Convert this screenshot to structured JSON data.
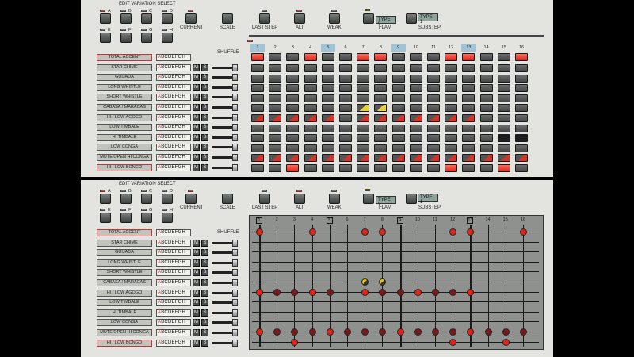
{
  "colors": {
    "panel": "#e3e3df",
    "accent_red": "#e2231a",
    "flam_yellow": "#f0d838",
    "lcd": "#8ea39a",
    "step_highlight": "#9fc4d8"
  },
  "top": {
    "edit_variation_select": "EDIT VARIATION SELECT",
    "variation_buttons": [
      "A",
      "B",
      "C",
      "D",
      "E",
      "F",
      "G",
      "H"
    ],
    "current": "CURRENT",
    "scale": "SCALE",
    "last_step": "LAST STEP",
    "alt": "ALT",
    "weak": "WEAK",
    "flam": "FLAM",
    "flam_type": "TYPE 2",
    "substep": "SUBSTEP",
    "substep_type": "TYPE 1",
    "shuffle": "SHUFFLE",
    "instruments": [
      "TOTAL ACCENT",
      "STAR CHIME",
      "GUIJADA",
      "LONG WHISTLE",
      "SHORT WHISTLE",
      "CABASA / MARACAS",
      "HI / LOW AGOGO",
      "LOW TIMBALE",
      "HI TIMBALE",
      "LOW CONGA",
      "MUTE/OPEN HI CONGA",
      "HI / LOW BONGO"
    ],
    "variation_letters": [
      "A",
      "B",
      "C",
      "D",
      "E",
      "F",
      "G",
      "H"
    ],
    "mute": "M",
    "solo": "S",
    "steps": [
      "1",
      "2",
      "3",
      "4",
      "5",
      "6",
      "7",
      "8",
      "9",
      "10",
      "11",
      "12",
      "13",
      "14",
      "15",
      "16"
    ]
  },
  "bottom": {
    "edit_variation_select": "EDIT VARIATION SELECT",
    "variation_buttons": [
      "A",
      "B",
      "C",
      "D",
      "E",
      "F",
      "G",
      "H"
    ],
    "current": "CURRENT",
    "scale": "SCALE",
    "last_step": "LAST STEP",
    "alt": "ALT",
    "weak": "WEAK",
    "flam": "FLAM",
    "flam_type": "TYPE 2",
    "substep": "SUBSTEP",
    "substep_type": "TYPE 1",
    "shuffle": "SHUFFLE",
    "instruments": [
      "TOTAL ACCENT",
      "STAR CHIME",
      "GUIJADA",
      "LONG WHISTLE",
      "SHORT WHISTLE",
      "CABASA / MARACAS",
      "HI / LOW AGOGO",
      "LOW TIMBALE",
      "HI TIMBALE",
      "LOW CONGA",
      "MUTE/OPEN HI CONGA",
      "HI / LOW BONGO"
    ],
    "steps": [
      "1",
      "2",
      "3",
      "4",
      "5",
      "6",
      "7",
      "8",
      "9",
      "10",
      "11",
      "12",
      "13",
      "14",
      "15",
      "16"
    ]
  },
  "pattern": {
    "accent": [
      1,
      0,
      0,
      1,
      0,
      0,
      1,
      1,
      0,
      0,
      0,
      1,
      1,
      0,
      0,
      1
    ],
    "agogo": [
      2,
      2,
      2,
      2,
      2,
      0,
      2,
      2,
      2,
      2,
      2,
      2,
      2,
      0,
      0,
      0
    ],
    "flam_row": [
      0,
      0,
      0,
      0,
      0,
      0,
      3,
      3,
      0,
      0,
      0,
      0,
      0,
      0,
      0,
      0
    ],
    "hi_timbale_dark": [
      0,
      0,
      0,
      0,
      0,
      0,
      0,
      0,
      0,
      0,
      0,
      0,
      0,
      0,
      4,
      4
    ],
    "mute_conga": [
      2,
      2,
      2,
      2,
      2,
      2,
      2,
      2,
      2,
      2,
      2,
      2,
      2,
      2,
      2,
      2
    ],
    "bongo": [
      0,
      0,
      1,
      0,
      0,
      0,
      0,
      0,
      0,
      0,
      0,
      1,
      0,
      0,
      1,
      0
    ]
  }
}
